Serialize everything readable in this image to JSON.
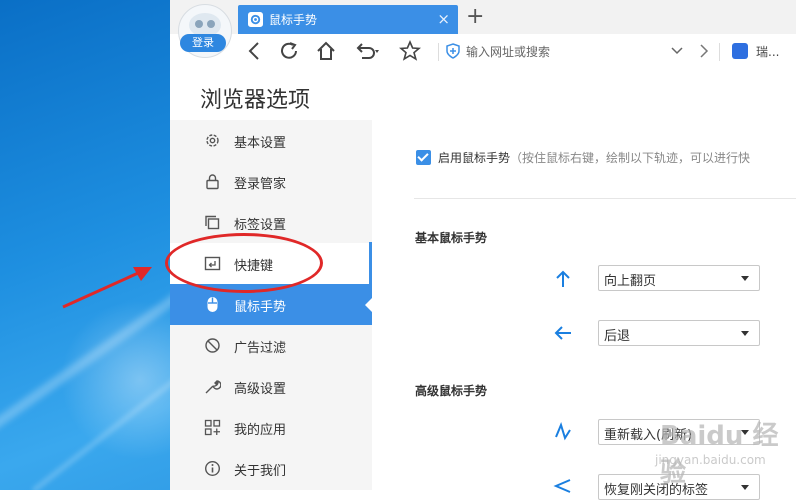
{
  "colors": {
    "accent": "#3b8fe6",
    "annotation": "#e02828"
  },
  "tab": {
    "title": "鼠标手势",
    "close": "×",
    "new_tab": "+"
  },
  "profile": {
    "login_label": "登录"
  },
  "toolbar": {
    "address_placeholder": "输入网址或搜索",
    "search_text": "瑞..."
  },
  "page": {
    "title": "浏览器选项"
  },
  "sidebar": {
    "items": [
      {
        "label": "基本设置",
        "icon": "gear-icon"
      },
      {
        "label": "登录管家",
        "icon": "lock-icon"
      },
      {
        "label": "标签设置",
        "icon": "tabs-icon"
      },
      {
        "label": "快捷键",
        "icon": "keyboard-icon"
      },
      {
        "label": "鼠标手势",
        "icon": "mouse-icon"
      },
      {
        "label": "广告过滤",
        "icon": "block-icon"
      },
      {
        "label": "高级设置",
        "icon": "wrench-icon"
      },
      {
        "label": "我的应用",
        "icon": "apps-icon"
      },
      {
        "label": "关于我们",
        "icon": "info-icon"
      }
    ],
    "active_label": "鼠标手势"
  },
  "content": {
    "enable_checked": true,
    "enable_label": "启用鼠标手势",
    "enable_hint": "（按住鼠标右键，绘制以下轨迹，可以进行快",
    "basic_section": "基本鼠标手势",
    "advanced_section": "高级鼠标手势",
    "gestures": [
      {
        "icon": "arrow-up-icon",
        "value": "向上翻页"
      },
      {
        "icon": "arrow-left-icon",
        "value": "后退"
      },
      {
        "icon": "zigzag-icon",
        "value": "重新载入(刷新)"
      },
      {
        "icon": "zigzag-left-icon",
        "value": "恢复刚关闭的标签"
      }
    ]
  },
  "watermark": {
    "text": "Baidu 经验",
    "url": "jingyan.baidu.com"
  }
}
